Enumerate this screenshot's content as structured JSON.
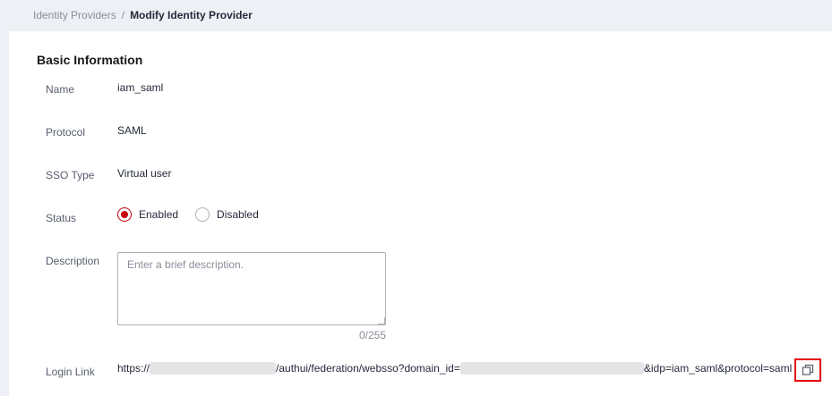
{
  "breadcrumb": {
    "parent": "Identity Providers",
    "separator": "/",
    "current": "Modify Identity Provider"
  },
  "section_title": "Basic Information",
  "fields": {
    "name": {
      "label": "Name",
      "value": "iam_saml"
    },
    "protocol": {
      "label": "Protocol",
      "value": "SAML"
    },
    "sso_type": {
      "label": "SSO Type",
      "value": "Virtual user"
    },
    "status": {
      "label": "Status",
      "options": [
        "Enabled",
        "Disabled"
      ],
      "selected": "Enabled"
    },
    "description": {
      "label": "Description",
      "placeholder": "Enter a brief description.",
      "value": "",
      "counter": "0/255"
    },
    "login_link": {
      "label": "Login Link",
      "prefix": "https://",
      "middle": "/authui/federation/websso?domain_id=",
      "suffix": "&idp=iam_saml&protocol=saml"
    }
  },
  "icons": {
    "copy": "copy-icon"
  },
  "colors": {
    "accent": "#c7000b",
    "highlight_box": "#e1000f"
  }
}
